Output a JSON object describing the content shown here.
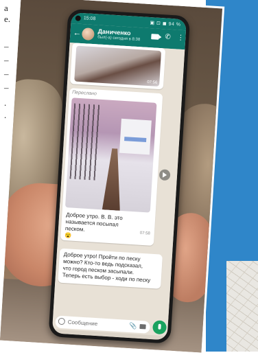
{
  "page_fragment": {
    "lines": [
      "а",
      "е.",
      "–",
      "–",
      "–",
      "–",
      ".",
      "."
    ]
  },
  "phone": {
    "status": {
      "time": "15:08",
      "right": "▣ ⊡ ◼ 94 %"
    },
    "appbar": {
      "contact_name": "Даниченко",
      "contact_status": "был(-а) сегодня в 8:38"
    },
    "messages": [
      {
        "time": "07:56"
      },
      {
        "forwarded_label": "Переслано",
        "text_lines": [
          "Доброе утро. В. В. это",
          "называется посыпал",
          "песком."
        ],
        "time": "07:58",
        "reaction": "😮"
      },
      {
        "text_lines": [
          "Доброе утро! Пройти по песку",
          "можно? Кто-то ведь подсказал,",
          "что город песком засыпали.",
          "Теперь есть выбор - ходи по песку"
        ]
      }
    ],
    "input": {
      "placeholder": "Сообщение"
    }
  },
  "colors": {
    "whatsapp_header": "#0e7a6e",
    "mic_button": "#1aa25f",
    "chat_background": "#e8e1d6",
    "page_accent_blue": "#2f86c9"
  },
  "icons": [
    "back-icon",
    "video-call-icon",
    "phone-call-icon",
    "menu-icon",
    "share-icon",
    "emoji-icon",
    "attach-icon",
    "camera-icon",
    "mic-icon"
  ]
}
